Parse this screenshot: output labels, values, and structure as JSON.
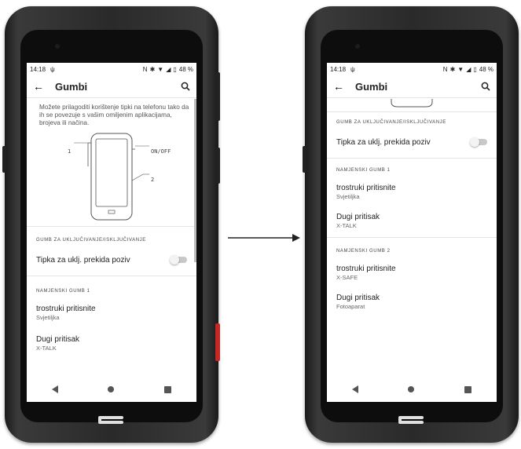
{
  "left": {
    "status": {
      "time": "14:18",
      "battery": "48 %"
    },
    "appbar": {
      "title": "Gumbi"
    },
    "description": "Možete prilagoditi korištenje tipki na telefonu tako da ih se povezuje s vašim omiljenim aplikacijama, brojeva ili načina.",
    "diagram": {
      "label_1": "1",
      "label_onoff": "ON/OFF",
      "label_2": "2"
    },
    "section_power": "GUMB ZA UKLJUČIVANJE/ISKLJUČIVANJE",
    "toggle_item": "Tipka za uklj. prekida poziv",
    "section_btn1": "NAMJENSKI GUMB 1",
    "items": [
      {
        "title": "trostruki pritisnite",
        "sub": "Svjetiljka"
      },
      {
        "title": "Dugi pritisak",
        "sub": "X-TALK"
      }
    ]
  },
  "right": {
    "status": {
      "time": "14:18",
      "battery": "48 %"
    },
    "appbar": {
      "title": "Gumbi"
    },
    "section_power": "GUMB ZA UKLJUČIVANJE/ISKLJUČIVANJE",
    "toggle_item": "Tipka za uklj. prekida poziv",
    "section_btn1": "NAMJENSKI GUMB 1",
    "btn1_items": [
      {
        "title": "trostruki pritisnite",
        "sub": "Svjetiljka"
      },
      {
        "title": "Dugi pritisak",
        "sub": "X-TALK"
      }
    ],
    "section_btn2": "NAMJENSKI GUMB 2",
    "btn2_items": [
      {
        "title": "trostruki pritisnite",
        "sub": "X-SAFE"
      },
      {
        "title": "Dugi pritisak",
        "sub": "Fotoaparat"
      }
    ]
  },
  "colors": {
    "accent": "#222222",
    "toggle_track": "#c8c8c8",
    "phone_body": "#2a2a2a"
  }
}
